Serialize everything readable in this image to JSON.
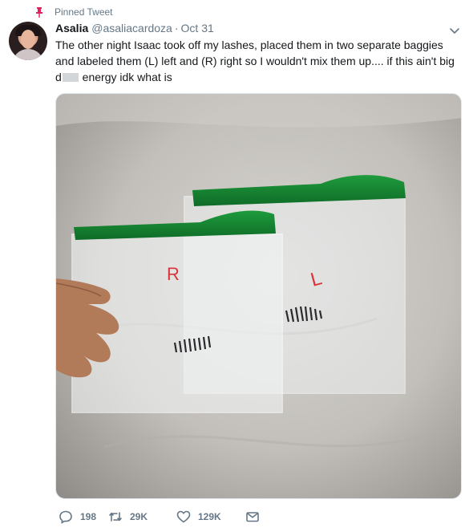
{
  "pinned": {
    "label": "Pinned Tweet",
    "icon": "pin-icon",
    "color": "#e0245e"
  },
  "author": {
    "name": "Asalia",
    "handle": "@asaliacardoza",
    "separator": "·",
    "date": "Oct 31"
  },
  "tweet": {
    "text_before_censor": "The other night Isaac took off my lashes, placed them in two separate baggies and labeled them (L) left and (R) right so I wouldn't mix them up.... if this ain't big d",
    "text_after_censor": " energy idk what is"
  },
  "photo": {
    "bag_labels": {
      "left_bag": "R",
      "right_bag": "L"
    }
  },
  "actions": {
    "reply_count": "198",
    "retweet_count": "29K",
    "like_count": "129K"
  },
  "colors": {
    "text": "#14171a",
    "muted": "#657786",
    "pin": "#e0245e"
  }
}
